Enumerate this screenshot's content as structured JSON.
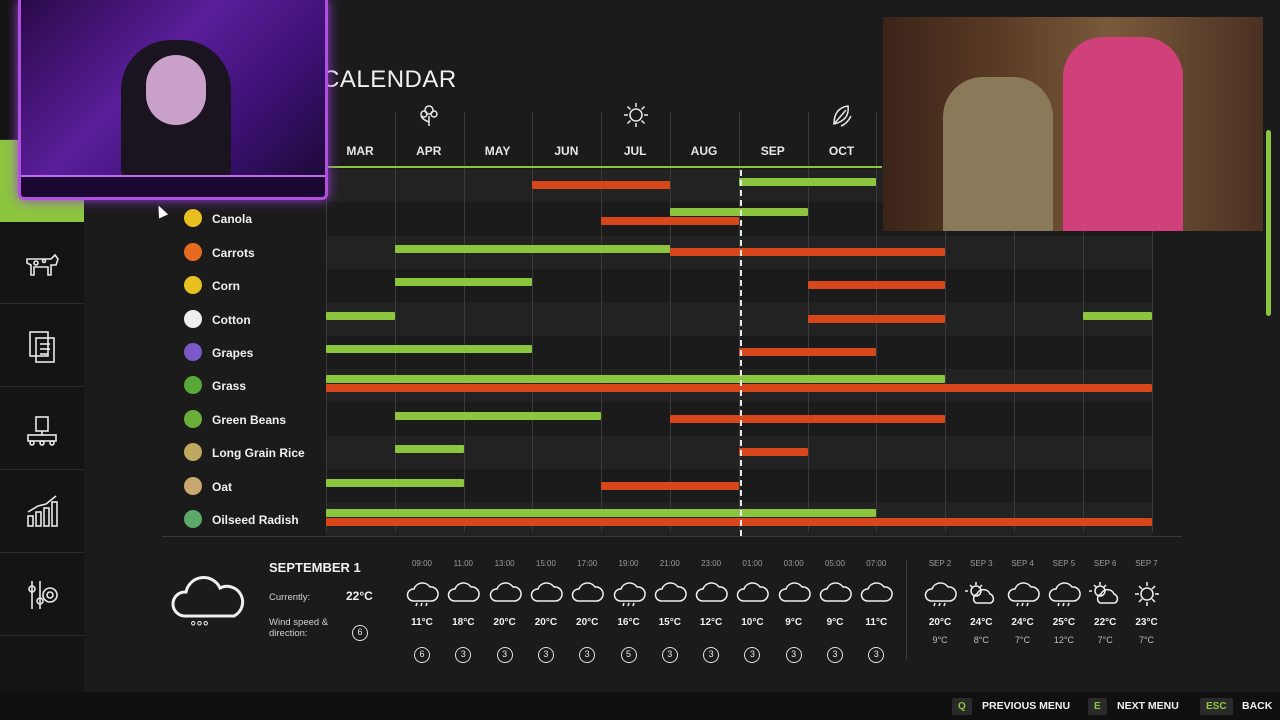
{
  "page": {
    "title": "CALENDAR"
  },
  "colors": {
    "accent": "#8cc63f",
    "planting": "#8cc63f",
    "harvest": "#d8471c",
    "background": "#1b1b1b"
  },
  "sidebar": {
    "items": [
      {
        "icon": "calendar-icon",
        "active": true
      },
      {
        "icon": "cow-icon"
      },
      {
        "icon": "documents-icon"
      },
      {
        "icon": "factory-icon"
      },
      {
        "icon": "bar-chart-icon"
      },
      {
        "icon": "settings-sliders-icon"
      }
    ]
  },
  "calendar": {
    "months": [
      "MAR",
      "APR",
      "MAY",
      "JUN",
      "JUL",
      "AUG",
      "SEP",
      "OCT"
    ],
    "season_icons": [
      "flower-icon",
      "sun-icon",
      "leaves-icon"
    ],
    "today_month_index": 6,
    "crops": [
      {
        "name": "",
        "icon": "crop-icon",
        "plant": [
          [
            6,
            8
          ]
        ],
        "harvest": [
          [
            3,
            5
          ]
        ]
      },
      {
        "name": "Canola",
        "icon": "canola-icon",
        "plant": [
          [
            5,
            7
          ]
        ],
        "harvest": [
          [
            4,
            6
          ]
        ]
      },
      {
        "name": "Carrots",
        "icon": "carrot-icon",
        "plant": [
          [
            1,
            5
          ]
        ],
        "harvest": [
          [
            5,
            9
          ]
        ]
      },
      {
        "name": "Corn",
        "icon": "corn-icon",
        "plant": [
          [
            1,
            3
          ]
        ],
        "harvest": [
          [
            7,
            9
          ]
        ]
      },
      {
        "name": "Cotton",
        "icon": "cotton-icon",
        "plant": [
          [
            0,
            1
          ],
          [
            11,
            12
          ]
        ],
        "harvest": [
          [
            7,
            9
          ]
        ]
      },
      {
        "name": "Grapes",
        "icon": "grapes-icon",
        "plant": [
          [
            0,
            3
          ]
        ],
        "harvest": [
          [
            6,
            8
          ]
        ]
      },
      {
        "name": "Grass",
        "icon": "grass-icon",
        "plant": [
          [
            0,
            9
          ]
        ],
        "harvest": [
          [
            0,
            12
          ]
        ]
      },
      {
        "name": "Green Beans",
        "icon": "bean-icon",
        "plant": [
          [
            1,
            4
          ]
        ],
        "harvest": [
          [
            5,
            9
          ]
        ]
      },
      {
        "name": "Long Grain Rice",
        "icon": "rice-icon",
        "plant": [
          [
            1,
            2
          ]
        ],
        "harvest": [
          [
            6,
            7
          ]
        ]
      },
      {
        "name": "Oat",
        "icon": "oat-icon",
        "plant": [
          [
            0,
            2
          ]
        ],
        "harvest": [
          [
            4,
            6
          ]
        ]
      },
      {
        "name": "Oilseed Radish",
        "icon": "radish-icon",
        "plant": [
          [
            0,
            8
          ]
        ],
        "harvest": [
          [
            0,
            12
          ]
        ]
      }
    ]
  },
  "weather": {
    "date": "SEPTEMBER 1",
    "current_label": "Currently:",
    "current_temp": "22°C",
    "wind_label": "Wind speed & direction:",
    "wind_value": "6",
    "icon": "rain-cloud-icon",
    "hourly": [
      {
        "time": "09:00",
        "icon": "rain-cloud-icon",
        "temp": "11°C",
        "wind": "6"
      },
      {
        "time": "11:00",
        "icon": "cloud-icon",
        "temp": "18°C",
        "wind": "3"
      },
      {
        "time": "13:00",
        "icon": "cloud-icon",
        "temp": "20°C",
        "wind": "3"
      },
      {
        "time": "15:00",
        "icon": "cloud-icon",
        "temp": "20°C",
        "wind": "3"
      },
      {
        "time": "17:00",
        "icon": "cloud-icon",
        "temp": "20°C",
        "wind": "3"
      },
      {
        "time": "19:00",
        "icon": "rain-cloud-icon",
        "temp": "16°C",
        "wind": "5"
      },
      {
        "time": "21:00",
        "icon": "cloud-icon",
        "temp": "15°C",
        "wind": "3"
      },
      {
        "time": "23:00",
        "icon": "cloud-icon",
        "temp": "12°C",
        "wind": "3"
      },
      {
        "time": "01:00",
        "icon": "cloud-icon",
        "temp": "10°C",
        "wind": "3"
      },
      {
        "time": "03:00",
        "icon": "cloud-icon",
        "temp": "9°C",
        "wind": "3"
      },
      {
        "time": "05:00",
        "icon": "cloud-icon",
        "temp": "9°C",
        "wind": "3"
      },
      {
        "time": "07:00",
        "icon": "cloud-icon",
        "temp": "11°C",
        "wind": "3"
      }
    ],
    "daily": [
      {
        "day": "SEP 2",
        "icon": "rain-cloud-icon",
        "hi": "20°C",
        "lo": "9°C"
      },
      {
        "day": "SEP 3",
        "icon": "sun-cloud-icon",
        "hi": "24°C",
        "lo": "8°C"
      },
      {
        "day": "SEP 4",
        "icon": "rain-cloud-icon",
        "hi": "24°C",
        "lo": "7°C"
      },
      {
        "day": "SEP 5",
        "icon": "rain-cloud-icon",
        "hi": "25°C",
        "lo": "12°C"
      },
      {
        "day": "SEP 6",
        "icon": "sun-cloud-icon",
        "hi": "22°C",
        "lo": "7°C"
      },
      {
        "day": "SEP 7",
        "icon": "sun-icon",
        "hi": "23°C",
        "lo": "7°C"
      }
    ]
  },
  "footer": {
    "prev": {
      "key": "Q",
      "label": "PREVIOUS MENU"
    },
    "next": {
      "key": "E",
      "label": "NEXT MENU"
    },
    "back": {
      "key": "ESC",
      "label": "BACK"
    }
  }
}
